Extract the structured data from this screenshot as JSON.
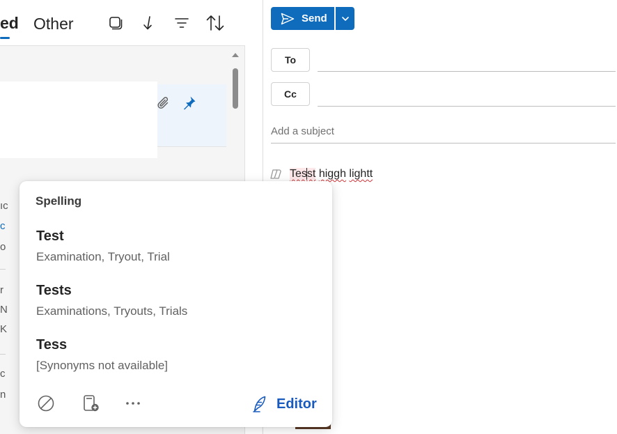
{
  "list": {
    "tabs": [
      {
        "label": "ed",
        "selected": true
      },
      {
        "label": "Other",
        "selected": false
      }
    ],
    "toolbar_icons": [
      "select-mode-icon",
      "jump-to-icon",
      "filter-icon",
      "sort-icon"
    ],
    "card_icons": [
      "paperclip-icon",
      "pin-icon"
    ],
    "edge_fragments": [
      "ıc",
      "c",
      "o",
      "r",
      "N",
      "K",
      "c",
      "n"
    ]
  },
  "compose": {
    "send_label": "Send",
    "to_label": "To",
    "cc_label": "Cc",
    "subject_placeholder": "Add a subject",
    "body": {
      "word1_a": "Tes",
      "word1_b": "st",
      "rest_space": " ",
      "word2": "higgh",
      "word3": "lightt"
    }
  },
  "spelling": {
    "title": "Spelling",
    "suggestions": [
      {
        "word": "Test",
        "synonyms": "Examination, Tryout, Trial"
      },
      {
        "word": "Tests",
        "synonyms": "Examinations, Tryouts, Trials"
      },
      {
        "word": "Tess",
        "synonyms": "[Synonyms not available]"
      }
    ],
    "editor_label": "Editor",
    "tools": [
      "ignore-icon",
      "add-to-dictionary-icon",
      "more-options-icon",
      "editor-pen-icon"
    ]
  },
  "colors": {
    "accent": "#0f6cbd",
    "editor": "#185abd",
    "misspelling": "#d13438"
  }
}
